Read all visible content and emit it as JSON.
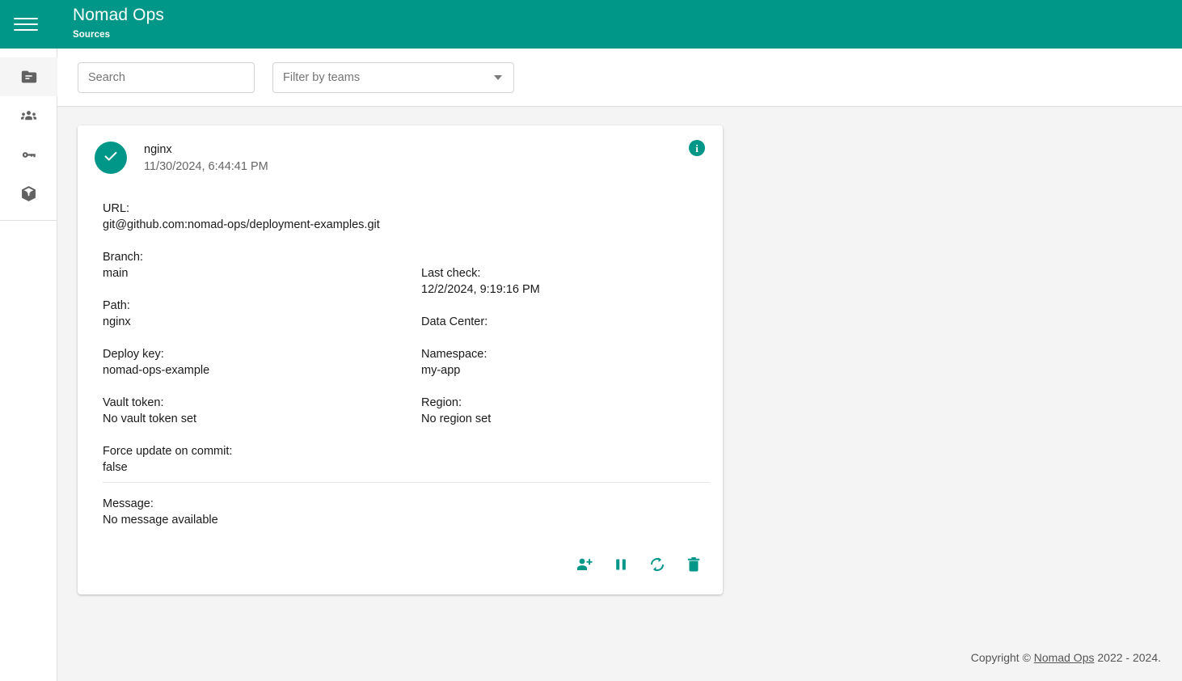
{
  "colors": {
    "primary": "#009688",
    "appbar_text": "#ffffff",
    "content_bg": "#f4f4f4",
    "card_bg": "#ffffff",
    "rail_selected": "#f5f5f5",
    "text": "#1a1a1a",
    "muted_text": "#666666"
  },
  "appbar": {
    "menu_icon": "hamburger-menu-icon",
    "title": "Nomad Ops",
    "subtitle": "Sources"
  },
  "sidebar": {
    "items": [
      {
        "icon": "folder-icon",
        "name": "sources",
        "selected": true
      },
      {
        "icon": "groups-icon",
        "name": "teams",
        "selected": false
      },
      {
        "icon": "key-icon",
        "name": "deploy-keys",
        "selected": false
      },
      {
        "icon": "package-cube-icon",
        "name": "deployments",
        "selected": false
      }
    ]
  },
  "toolbar": {
    "search": {
      "placeholder": "Search",
      "value": ""
    },
    "team_filter": {
      "label": "Filter by teams",
      "icon": "chevron-down-icon"
    }
  },
  "source_card": {
    "status_icon": "check-icon",
    "title": "nginx",
    "timestamp": "11/30/2024, 6:44:41 PM",
    "info_icon": "info-icon",
    "info_glyph": "i",
    "left_fields": [
      {
        "label": "URL:",
        "value": "git@github.com:nomad-ops/deployment-examples.git"
      },
      {
        "label": "Branch:",
        "value": "main"
      },
      {
        "label": "Path:",
        "value": "nginx"
      },
      {
        "label": "Deploy key:",
        "value": "nomad-ops-example"
      },
      {
        "label": "Vault token:",
        "value": "No vault token set"
      },
      {
        "label": "Force update on commit:",
        "value": "false"
      }
    ],
    "right_fields": [
      {
        "label": "Last check:",
        "value": "12/2/2024, 9:19:16 PM"
      },
      {
        "label": "Data Center:",
        "value": ""
      },
      {
        "label": "Namespace:",
        "value": "my-app"
      },
      {
        "label": "Region:",
        "value": "No region set"
      }
    ],
    "message": {
      "label": "Message:",
      "value": "No message available"
    },
    "actions": [
      {
        "name": "add-member-button",
        "icon": "person-add-icon"
      },
      {
        "name": "pause-button",
        "icon": "pause-icon"
      },
      {
        "name": "sync-button",
        "icon": "sync-icon"
      },
      {
        "name": "delete-button",
        "icon": "trash-icon"
      }
    ]
  },
  "footer": {
    "prefix": "Copyright © ",
    "link": "Nomad Ops",
    "suffix": " 2022 - 2024."
  }
}
